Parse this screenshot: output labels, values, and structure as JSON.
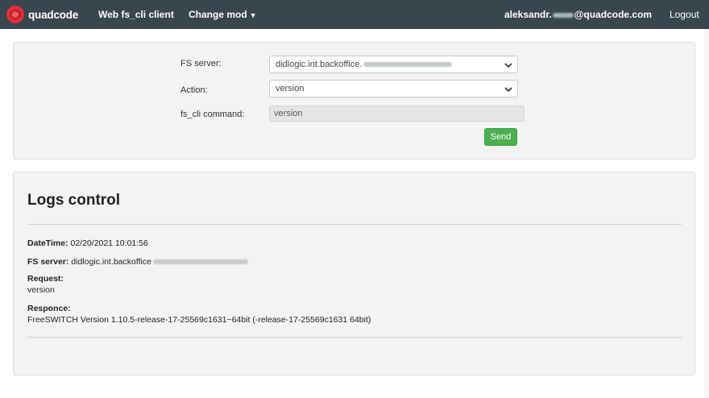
{
  "navbar": {
    "brand": "quadcode",
    "title": "Web fs_cli client",
    "change_mod": "Change mod",
    "user_prefix": "aleksandr.",
    "user_suffix": "@quadcode.com",
    "logout": "Logout",
    "background": "#39464d"
  },
  "form": {
    "fs_server_label": "FS server:",
    "fs_server_value": "didlogic.int.backoffice.",
    "action_label": "Action:",
    "action_value": "version",
    "command_label": "fs_cli command:",
    "command_value": "version",
    "send_label": "Send",
    "send_color": "#4caf50"
  },
  "logs": {
    "title": "Logs control",
    "datetime_label": "DateTime:",
    "datetime_value": "02/20/2021 10:01:56",
    "fs_server_label": "FS server:",
    "fs_server_value": "didlogic.int.backoffice",
    "request_label": "Request:",
    "request_value": "version",
    "response_label": "Responce:",
    "response_value": "FreeSWITCH Version 1.10.5-release-17-25569c1631~64bit (-release-17-25569c1631 64bit)"
  }
}
